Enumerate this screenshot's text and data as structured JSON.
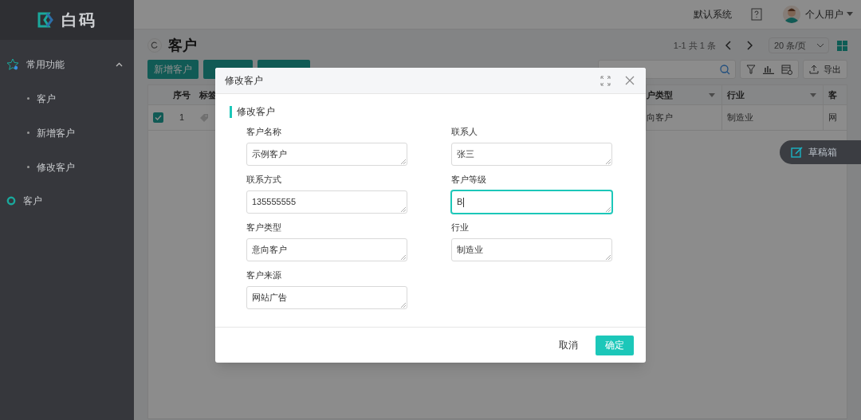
{
  "sidebar": {
    "logo": "白码",
    "menu": [
      {
        "label": "常用功能",
        "expanded": true,
        "children": [
          {
            "label": "客户"
          },
          {
            "label": "新增客户"
          },
          {
            "label": "修改客户"
          }
        ]
      },
      {
        "label": "客户"
      }
    ]
  },
  "topbar": {
    "system": "默认系统",
    "user": "个人用户"
  },
  "page": {
    "title": "客户",
    "pagination": "1-1 共 1 条",
    "page_size": "20 条/页",
    "actions": [
      "新增客户"
    ],
    "export": "导出",
    "table": {
      "columns": [
        "序号",
        "标签",
        "户类型",
        "行业",
        "客"
      ],
      "rows": [
        {
          "selected": true,
          "cells": [
            "1",
            "",
            "向客户",
            "制造业",
            "网"
          ]
        }
      ]
    }
  },
  "draft_box": "草稿箱",
  "dialog": {
    "title": "修改客户",
    "section": "修改客户",
    "fields": [
      {
        "label": "客户名称",
        "value": "示例客户",
        "focused": false
      },
      {
        "label": "联系人",
        "value": "张三",
        "focused": false
      },
      {
        "label": "联系方式",
        "value": "135555555",
        "focused": false
      },
      {
        "label": "客户等级",
        "value": "B",
        "focused": true
      },
      {
        "label": "客户类型",
        "value": "意向客户",
        "focused": false
      },
      {
        "label": "行业",
        "value": "制造业",
        "focused": false
      },
      {
        "label": "客户来源",
        "value": "网站广告",
        "focused": false
      }
    ],
    "buttons": [
      {
        "label": "取消",
        "kind": "text"
      },
      {
        "label": "确定",
        "kind": "primary"
      }
    ]
  }
}
